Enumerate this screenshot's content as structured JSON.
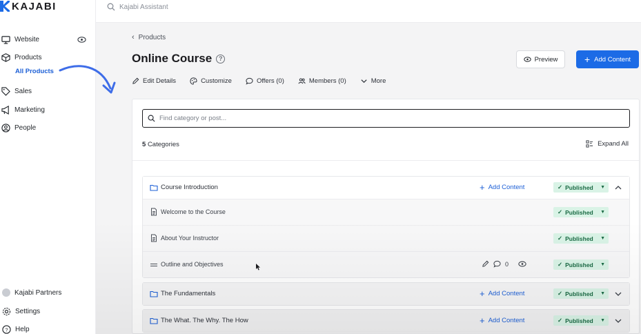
{
  "brand": {
    "name": "KAJABI",
    "color": "#1c6be6"
  },
  "sidebar": {
    "items": [
      {
        "label": "Website",
        "icon": "monitor-icon"
      },
      {
        "label": "Products",
        "icon": "cube-icon"
      },
      {
        "label": "Sales",
        "icon": "tag-icon"
      },
      {
        "label": "Marketing",
        "icon": "megaphone-icon"
      },
      {
        "label": "People",
        "icon": "person-circle-icon"
      }
    ],
    "sub_item": "All Products",
    "bottom": [
      {
        "label": "Kajabi Partners",
        "icon": "avatar"
      },
      {
        "label": "Settings",
        "icon": "gear-icon"
      },
      {
        "label": "Help",
        "icon": "help-circle-icon"
      }
    ]
  },
  "topbar": {
    "assistant_placeholder": "Kajabi Assistant"
  },
  "header": {
    "breadcrumb": "Products",
    "title": "Online Course",
    "help_glyph": "?",
    "preview_label": "Preview",
    "add_content_label": "Add Content"
  },
  "tabs": [
    {
      "label": "Edit Details",
      "icon": "pencil-icon"
    },
    {
      "label": "Customize",
      "icon": "palette-icon"
    },
    {
      "label": "Offers (0)",
      "icon": "tag-icon"
    },
    {
      "label": "Members (0)",
      "icon": "users-icon"
    },
    {
      "label": "More",
      "icon": "chevron-down-icon"
    }
  ],
  "content": {
    "search_placeholder": "Find category or post...",
    "count_number": "5",
    "count_label": "Categories",
    "expand_label": "Expand All",
    "add_content_label": "Add Content",
    "status_label": "Published",
    "status_color": "#d9f3e6",
    "categories": [
      {
        "title": "Course Introduction",
        "expanded": true,
        "posts": [
          {
            "title": "Welcome to the Course",
            "icon": "document-icon"
          },
          {
            "title": "About Your Instructor",
            "icon": "document-icon"
          },
          {
            "title": "Outline and Objectives",
            "icon": "drag-handle-icon",
            "comments": "0"
          }
        ]
      },
      {
        "title": "The Fundamentals",
        "expanded": false
      },
      {
        "title": "The What. The Why. The How",
        "expanded": false
      }
    ]
  }
}
